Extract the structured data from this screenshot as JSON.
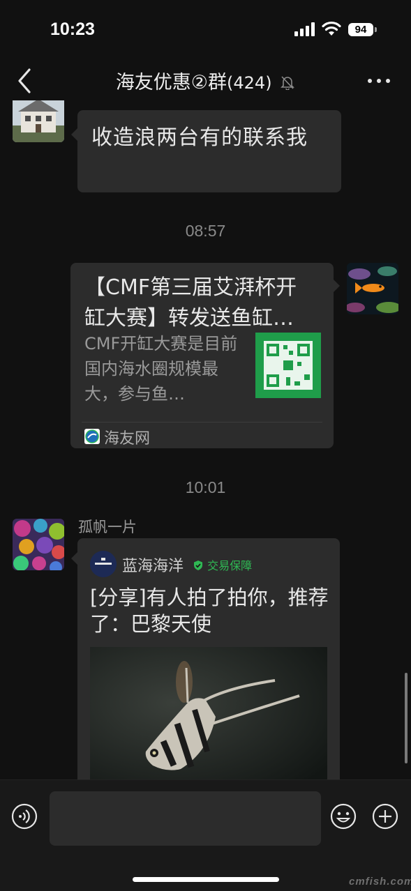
{
  "status_bar": {
    "time": "10:23",
    "battery": "94"
  },
  "nav": {
    "title": "海友优惠②群",
    "member_count": "(424)"
  },
  "messages": {
    "msg1": {
      "text": "收造浪两台有的联系我"
    },
    "time1": "08:57",
    "msg2": {
      "title": "【CMF第三届艾湃杯开缸大赛】转发送鱼缸…",
      "desc": "CMF开缸大赛是目前国内海水圈规模最大，参与鱼…",
      "source": "海友网"
    },
    "time2": "10:01",
    "msg3": {
      "sender": "孤帆一片",
      "account": "蓝海海洋",
      "badge": "交易保障",
      "title": "[分享]有人拍了拍你，推荐了：巴黎天使"
    }
  },
  "icons": {
    "back": "chevron-left-icon",
    "mute": "bell-slash-icon",
    "more": "ellipsis-icon",
    "voice": "voice-icon",
    "emoji": "smile-icon",
    "plus": "plus-circle-icon"
  },
  "watermark": "cmfish.com",
  "colors": {
    "background": "#111111",
    "bubble": "#2c2c2c",
    "badge": "#2fb954",
    "qr": "#1f9d4a"
  }
}
